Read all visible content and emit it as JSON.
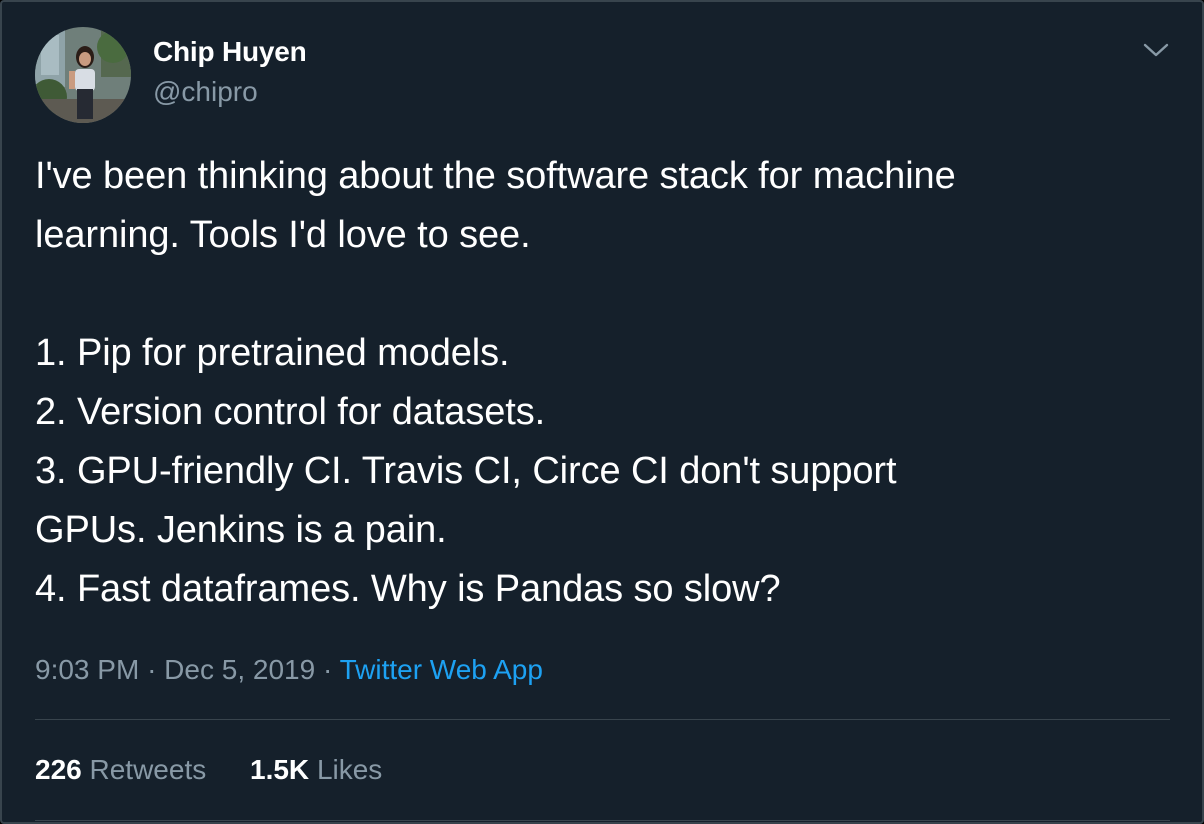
{
  "author": {
    "name": "Chip Huyen",
    "handle": "@chipro"
  },
  "tweet": {
    "text": "I've been thinking about the software stack for machine\nlearning. Tools I'd love to see.\n\n1. Pip for pretrained models.\n2. Version control for datasets.\n3. GPU-friendly CI. Travis CI, Circe CI don't support\nGPUs. Jenkins is a pain.\n4. Fast dataframes. Why is Pandas so slow?"
  },
  "meta": {
    "time": "9:03 PM",
    "separator": "·",
    "date": "Dec 5, 2019",
    "source": "Twitter Web App"
  },
  "stats": {
    "retweets_count": "226",
    "retweets_label": "Retweets",
    "likes_count": "1.5K",
    "likes_label": "Likes"
  },
  "icons": {
    "menu": "chevron-down-icon"
  },
  "colors": {
    "background": "#15202b",
    "primary_text": "#ffffff",
    "secondary_text": "#8899a6",
    "link": "#1da1f2",
    "divider": "#38444d"
  }
}
